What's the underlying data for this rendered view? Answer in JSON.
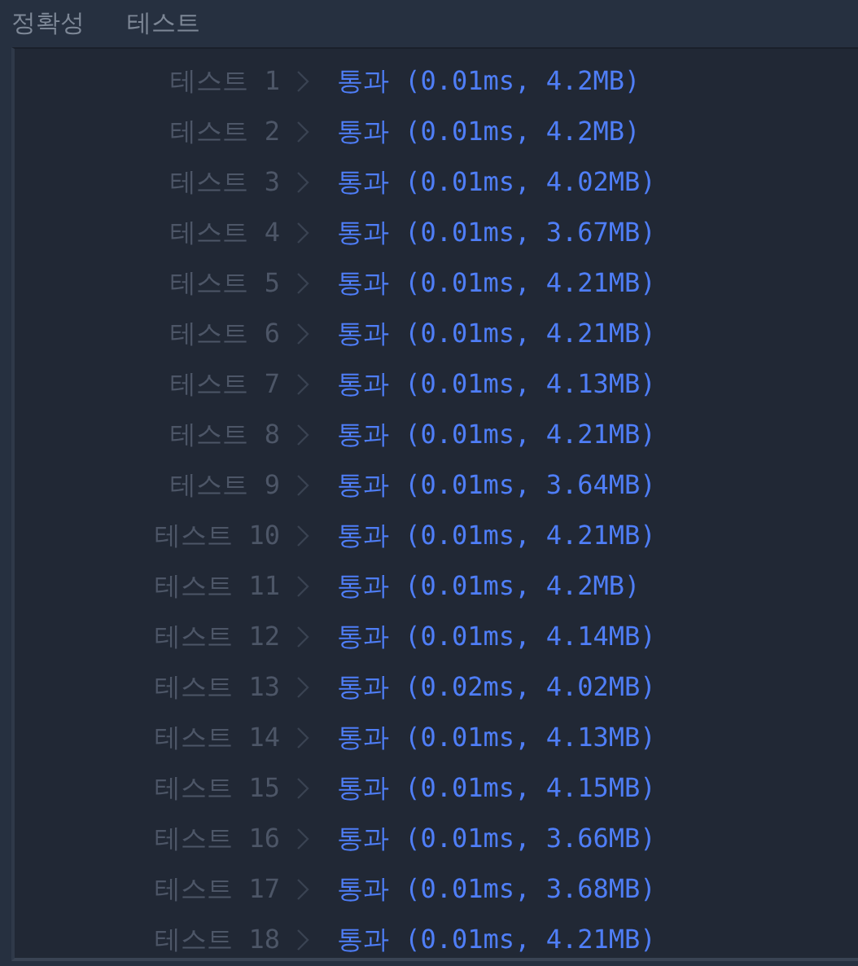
{
  "header": [
    "정확성",
    "테스트"
  ],
  "rows": [
    {
      "label": "테스트 1",
      "result": "통과 (0.01ms, 4.2MB)"
    },
    {
      "label": "테스트 2",
      "result": "통과 (0.01ms, 4.2MB)"
    },
    {
      "label": "테스트 3",
      "result": "통과 (0.01ms, 4.02MB)"
    },
    {
      "label": "테스트 4",
      "result": "통과 (0.01ms, 3.67MB)"
    },
    {
      "label": "테스트 5",
      "result": "통과 (0.01ms, 4.21MB)"
    },
    {
      "label": "테스트 6",
      "result": "통과 (0.01ms, 4.21MB)"
    },
    {
      "label": "테스트 7",
      "result": "통과 (0.01ms, 4.13MB)"
    },
    {
      "label": "테스트 8",
      "result": "통과 (0.01ms, 4.21MB)"
    },
    {
      "label": "테스트 9",
      "result": "통과 (0.01ms, 3.64MB)"
    },
    {
      "label": "테스트 10",
      "result": "통과 (0.01ms, 4.21MB)"
    },
    {
      "label": "테스트 11",
      "result": "통과 (0.01ms, 4.2MB)"
    },
    {
      "label": "테스트 12",
      "result": "통과 (0.01ms, 4.14MB)"
    },
    {
      "label": "테스트 13",
      "result": "통과 (0.02ms, 4.02MB)"
    },
    {
      "label": "테스트 14",
      "result": "통과 (0.01ms, 4.13MB)"
    },
    {
      "label": "테스트 15",
      "result": "통과 (0.01ms, 4.15MB)"
    },
    {
      "label": "테스트 16",
      "result": "통과 (0.01ms, 3.66MB)"
    },
    {
      "label": "테스트 17",
      "result": "통과 (0.01ms, 3.68MB)"
    },
    {
      "label": "테스트 18",
      "result": "통과 (0.01ms, 4.21MB)"
    }
  ]
}
